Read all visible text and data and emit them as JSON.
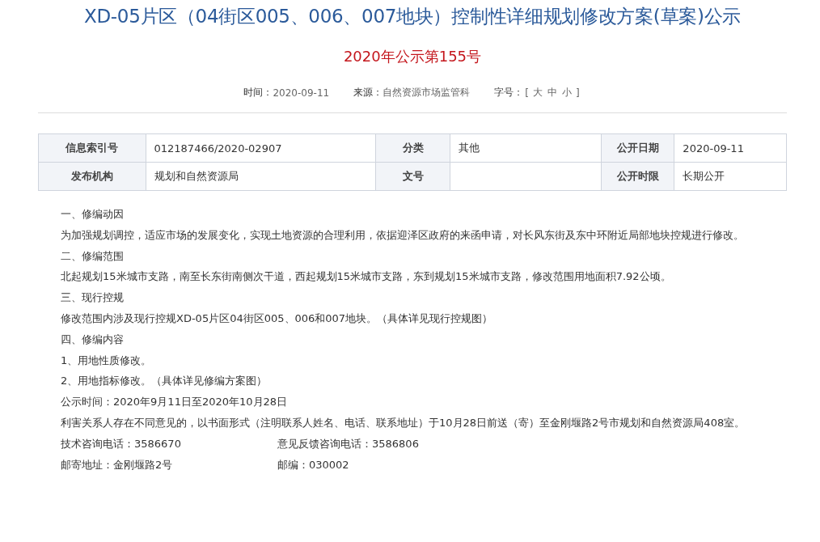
{
  "title": "XD-05片区（04街区005、006、007地块）控制性详细规划修改方案(草案)公示",
  "subtitle": "2020年公示第155号",
  "meta": {
    "time_label": "时间：",
    "time": "2020-09-11",
    "source_label": "来源：",
    "source": "自然资源市场监管科",
    "size_label": "字号：",
    "bracket_open": "[",
    "sizes": [
      "大",
      "中",
      "小"
    ],
    "bracket_close": "]"
  },
  "info_table": {
    "rows": [
      [
        {
          "label": "信息索引号",
          "value": "012187466/2020-02907"
        },
        {
          "label": "分类",
          "value": "其他"
        },
        {
          "label": "公开日期",
          "value": "2020-09-11"
        }
      ],
      [
        {
          "label": "发布机构",
          "value": "规划和自然资源局"
        },
        {
          "label": "文号"
        },
        {
          "label": "公开时限",
          "value": "长期公开"
        }
      ]
    ]
  },
  "body": [
    "一、修编动因",
    "为加强规划调控，适应市场的发展变化，实现土地资源的合理利用，依据迎泽区政府的来函申请，对长风东街及东中环附近局部地块控规进行修改。",
    "二、修编范围",
    "北起规划15米城市支路，南至长东街南侧次干道，西起规划15米城市支路，东到规划15米城市支路，修改范围用地面积7.92公顷。",
    "三、现行控规",
    "修改范围内涉及现行控规XD-05片区04街区005、006和007地块。（具体详见现行控规图）",
    "四、修编内容",
    "1、用地性质修改。",
    "2、用地指标修改。（具体详见修编方案图）",
    "公示时间：2020年9月11日至2020年10月28日",
    "利害关系人存在不同意见的，以书面形式（注明联系人姓名、电话、联系地址）于10月28日前送（寄）至金刚堰路2号市规划和自然资源局408室。"
  ],
  "contacts": [
    [
      "技术咨询电话：3586670",
      "意见反馈咨询电话：3586806"
    ],
    [
      "邮寄地址：金刚堰路2号",
      "邮编：030002"
    ]
  ]
}
